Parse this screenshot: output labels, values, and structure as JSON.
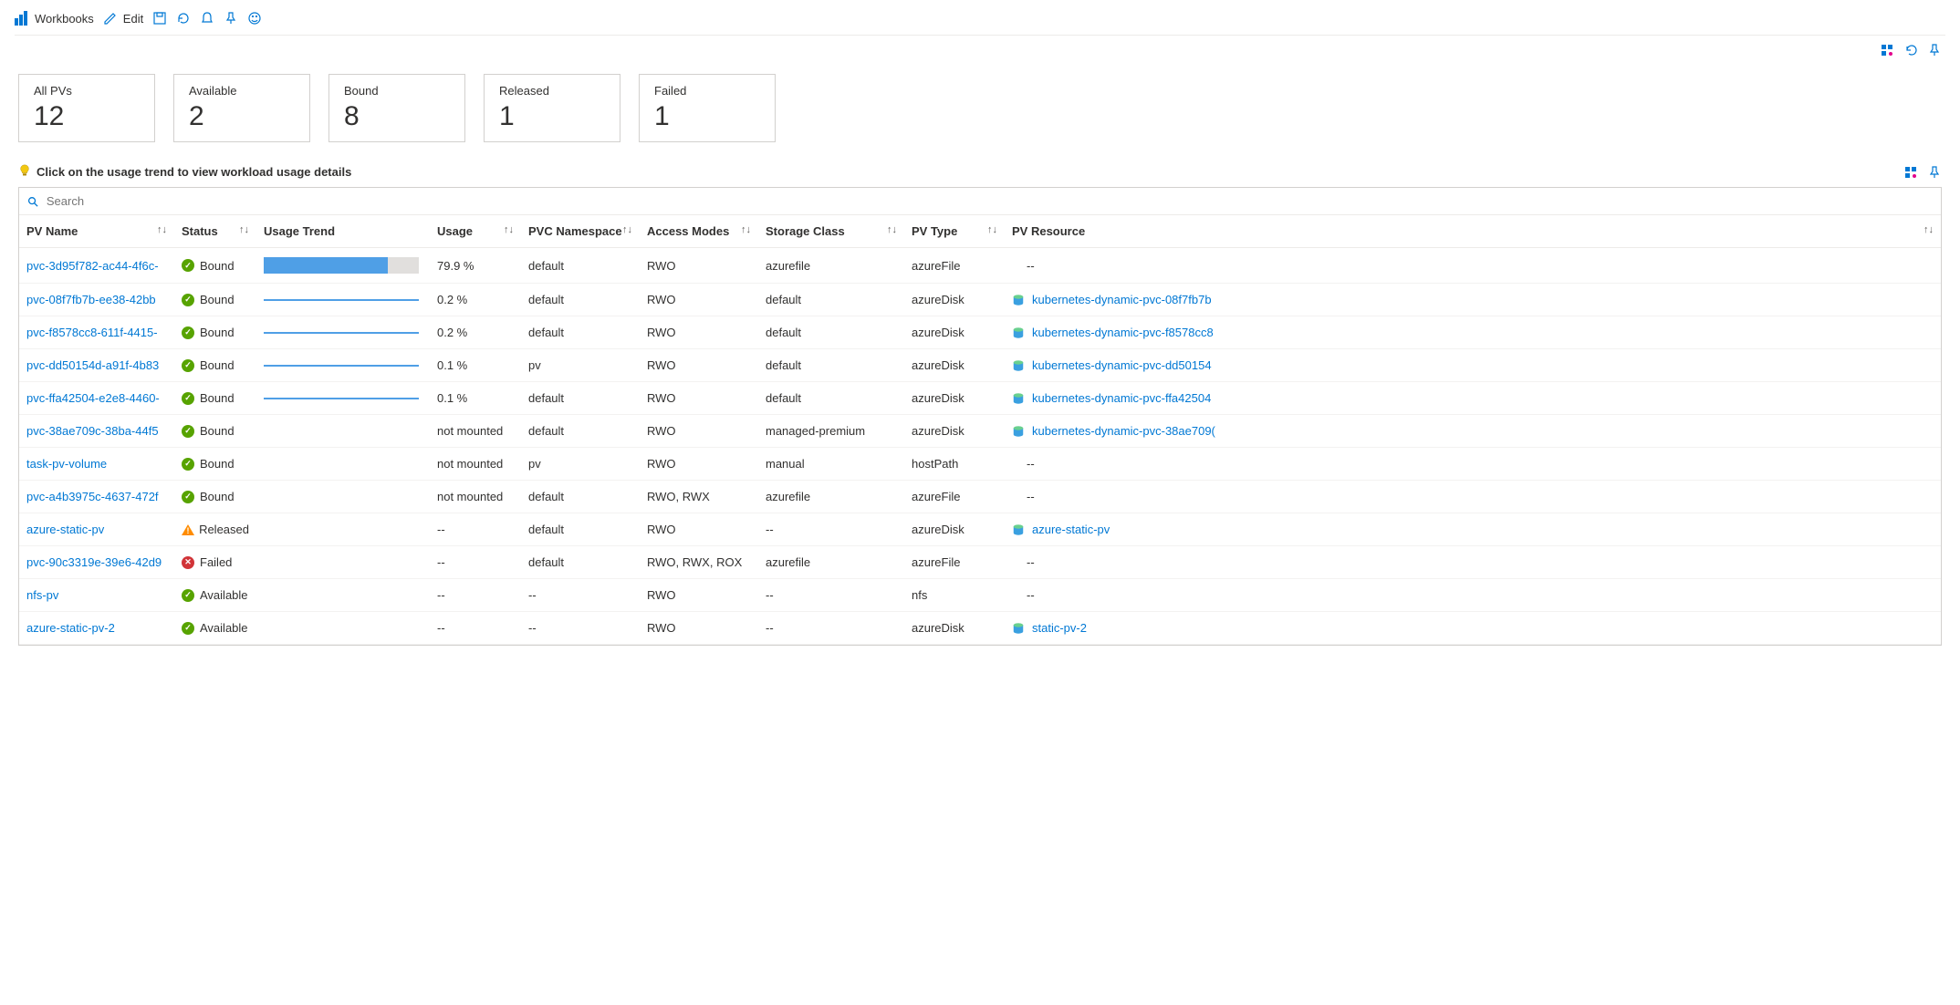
{
  "toolbar": {
    "workbooks_label": "Workbooks",
    "edit_label": "Edit"
  },
  "cards": [
    {
      "label": "All PVs",
      "value": "12"
    },
    {
      "label": "Available",
      "value": "2"
    },
    {
      "label": "Bound",
      "value": "8"
    },
    {
      "label": "Released",
      "value": "1"
    },
    {
      "label": "Failed",
      "value": "1"
    }
  ],
  "hint_text": "Click on the usage trend to view workload usage details",
  "search_placeholder": "Search",
  "columns": {
    "pv_name": "PV Name",
    "status": "Status",
    "usage_trend": "Usage Trend",
    "usage": "Usage",
    "pvc_namespace": "PVC Namespace",
    "access_modes": "Access Modes",
    "storage_class": "Storage Class",
    "pv_type": "PV Type",
    "pv_resource": "PV Resource"
  },
  "rows": [
    {
      "name": "pvc-3d95f782-ac44-4f6c-",
      "status": "Bound",
      "status_kind": "ok",
      "trend": "bar",
      "trend_pct": 80,
      "usage": "79.9 %",
      "ns": "default",
      "access": "RWO",
      "sc": "azurefile",
      "type": "azureFile",
      "res": "--",
      "res_link": false
    },
    {
      "name": "pvc-08f7fb7b-ee38-42bb",
      "status": "Bound",
      "status_kind": "ok",
      "trend": "underline",
      "usage": "0.2 %",
      "ns": "default",
      "access": "RWO",
      "sc": "default",
      "type": "azureDisk",
      "res": "kubernetes-dynamic-pvc-08f7fb7b",
      "res_link": true
    },
    {
      "name": "pvc-f8578cc8-611f-4415-",
      "status": "Bound",
      "status_kind": "ok",
      "trend": "underline",
      "usage": "0.2 %",
      "ns": "default",
      "access": "RWO",
      "sc": "default",
      "type": "azureDisk",
      "res": "kubernetes-dynamic-pvc-f8578cc8",
      "res_link": true
    },
    {
      "name": "pvc-dd50154d-a91f-4b83",
      "status": "Bound",
      "status_kind": "ok",
      "trend": "underline",
      "usage": "0.1 %",
      "ns": "pv",
      "access": "RWO",
      "sc": "default",
      "type": "azureDisk",
      "res": "kubernetes-dynamic-pvc-dd50154",
      "res_link": true
    },
    {
      "name": "pvc-ffa42504-e2e8-4460-",
      "status": "Bound",
      "status_kind": "ok",
      "trend": "underline",
      "usage": "0.1 %",
      "ns": "default",
      "access": "RWO",
      "sc": "default",
      "type": "azureDisk",
      "res": "kubernetes-dynamic-pvc-ffa42504",
      "res_link": true
    },
    {
      "name": "pvc-38ae709c-38ba-44f5",
      "status": "Bound",
      "status_kind": "ok",
      "trend": "none",
      "usage": "not mounted",
      "ns": "default",
      "access": "RWO",
      "sc": "managed-premium",
      "type": "azureDisk",
      "res": "kubernetes-dynamic-pvc-38ae709(",
      "res_link": true
    },
    {
      "name": "task-pv-volume",
      "status": "Bound",
      "status_kind": "ok",
      "trend": "none",
      "usage": "not mounted",
      "ns": "pv",
      "access": "RWO",
      "sc": "manual",
      "type": "hostPath",
      "res": "--",
      "res_link": false
    },
    {
      "name": "pvc-a4b3975c-4637-472f",
      "status": "Bound",
      "status_kind": "ok",
      "trend": "none",
      "usage": "not mounted",
      "ns": "default",
      "access": "RWO, RWX",
      "sc": "azurefile",
      "type": "azureFile",
      "res": "--",
      "res_link": false
    },
    {
      "name": "azure-static-pv",
      "status": "Released",
      "status_kind": "warn",
      "trend": "none",
      "usage": "--",
      "ns": "default",
      "access": "RWO",
      "sc": "--",
      "type": "azureDisk",
      "res": "azure-static-pv",
      "res_link": true
    },
    {
      "name": "pvc-90c3319e-39e6-42d9",
      "status": "Failed",
      "status_kind": "fail",
      "trend": "none",
      "usage": "--",
      "ns": "default",
      "access": "RWO, RWX, ROX",
      "sc": "azurefile",
      "type": "azureFile",
      "res": "--",
      "res_link": false
    },
    {
      "name": "nfs-pv",
      "status": "Available",
      "status_kind": "ok",
      "trend": "none",
      "usage": "--",
      "ns": "--",
      "access": "RWO",
      "sc": "--",
      "type": "nfs",
      "res": "--",
      "res_link": false
    },
    {
      "name": "azure-static-pv-2",
      "status": "Available",
      "status_kind": "ok",
      "trend": "none",
      "usage": "--",
      "ns": "--",
      "access": "RWO",
      "sc": "--",
      "type": "azureDisk",
      "res": "static-pv-2",
      "res_link": true
    }
  ]
}
